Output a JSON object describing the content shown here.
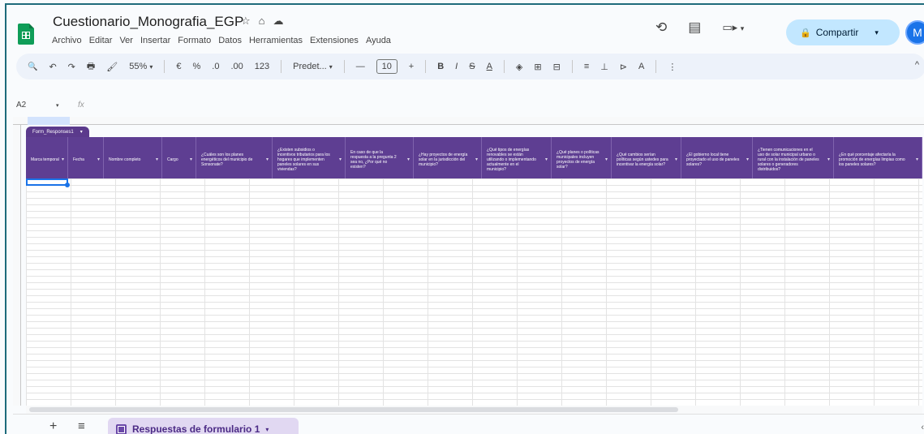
{
  "document": {
    "title": "Cuestionario_Monografia_EGP",
    "star_icon": "☆",
    "folder_icon": "⌂",
    "cloud_icon": "☁"
  },
  "menu": [
    "Archivo",
    "Editar",
    "Ver",
    "Insertar",
    "Formato",
    "Datos",
    "Herramientas",
    "Extensiones",
    "Ayuda"
  ],
  "header": {
    "history_icon": "⟲",
    "comments_icon": "▤",
    "meet_icon": "▭▸",
    "meet_caret": "▾",
    "share_label": "Compartir",
    "share_lock": "🔒",
    "share_caret": "▾",
    "avatar_letter": "M"
  },
  "toolbar": {
    "search": "🔍",
    "undo": "↶",
    "redo": "↷",
    "print": "🖶",
    "paint_format": "🖌",
    "zoom": "55%",
    "zoom_caret": "▾",
    "currency": "€",
    "percent": "%",
    "dec_decrease": ".0",
    "dec_increase": ".00",
    "num_format": "123",
    "font": "Predet...",
    "font_caret": "▾",
    "minus": "—",
    "font_size": "10",
    "plus": "+",
    "bold": "B",
    "italic": "I",
    "strike": "S",
    "text_color": "A",
    "fill": "◈",
    "borders": "⊞",
    "merge": "⊟",
    "align_h": "≡",
    "align_v": "⊥",
    "wrap": "⊳",
    "rotate": "A",
    "more": "⋮",
    "collapse": "^"
  },
  "formula_bar": {
    "cell_ref": "A2",
    "caret": "▾",
    "fx": "fx"
  },
  "table": {
    "tag_label": "Form_Responses1",
    "headers": [
      "Marca temporal",
      "Fecha",
      "Nombre completo",
      "Cargo",
      "¿Cuáles son los planes energéticos del municipio de Sonsonate?",
      "¿Existen subsidios o incentivos tributarios para los hogares que implementen paneles solares en sus viviendas?",
      "En caso de que la respuesta a la pregunta 2 sea no, ¿Por qué no existen?",
      "¿Hay proyectos de energía solar en la jurisdicción del municipio?",
      "¿Qué tipos de energías renovables se están utilizando o implementando actualmente en el municipio?",
      "¿Qué planes o políticas municipales incluyen proyectos de energía solar?",
      "¿Qué cambios serían políticas según ustedes para incentivar la energía solar?",
      "¿El gobierno local tiene proyectado el uso de paneles solares?",
      "¿Tienen comunicaciones en el uso de solar municipal urbano o rural con la instalación de paneles solares o generadores distribuidos?",
      "¿En qué porcentaje afectaría la promoción de energías limpias como los paneles solares?"
    ],
    "dropdown_icon": "▾"
  },
  "sheets": {
    "add": "+",
    "list": "≡",
    "active_tab": "Respuestas de formulario 1",
    "tab_caret": "▾",
    "side": "‹"
  }
}
